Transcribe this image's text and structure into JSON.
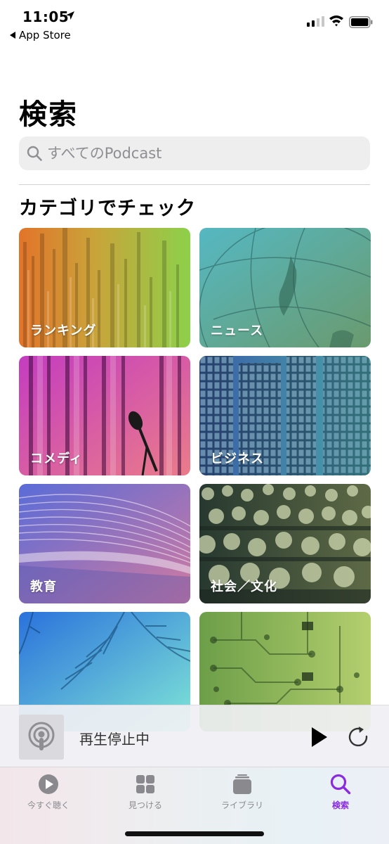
{
  "status_bar": {
    "time": "11:05",
    "back_app": "App Store"
  },
  "page": {
    "title": "検索"
  },
  "search": {
    "placeholder": "すべてのPodcast",
    "value": ""
  },
  "section": {
    "title": "カテゴリでチェック"
  },
  "categories": [
    {
      "label": "ランキング",
      "icon": "ranking-bars",
      "colors": [
        "#e67e22",
        "#8ed14a"
      ]
    },
    {
      "label": "ニュース",
      "icon": "globe",
      "colors": [
        "#4fb3bc",
        "#6a9e6a"
      ]
    },
    {
      "label": "コメディ",
      "icon": "curtain-microphone",
      "colors": [
        "#c040b8",
        "#e87a8a"
      ]
    },
    {
      "label": "ビジネス",
      "icon": "skyscrapers",
      "colors": [
        "#3a5fa8",
        "#4aa5a8"
      ]
    },
    {
      "label": "教育",
      "icon": "open-book",
      "colors": [
        "#5b6fd6",
        "#d07aa0"
      ]
    },
    {
      "label": "社会／文化",
      "icon": "crowd",
      "colors": [
        "#22332c",
        "#c9d68a"
      ]
    },
    {
      "label": "",
      "icon": "palm-leaves",
      "colors": [
        "#2f7fe0",
        "#7fe3d8"
      ]
    },
    {
      "label": "",
      "icon": "circuit-board",
      "colors": [
        "#6fa04a",
        "#b6d070"
      ]
    }
  ],
  "mini_player": {
    "status": "再生停止中"
  },
  "tabs": [
    {
      "label": "今すぐ聴く",
      "icon": "play-circle-icon",
      "active": false
    },
    {
      "label": "見つける",
      "icon": "grid-icon",
      "active": false
    },
    {
      "label": "ライブラリ",
      "icon": "library-icon",
      "active": false
    },
    {
      "label": "検索",
      "icon": "search-icon",
      "active": true
    }
  ],
  "colors": {
    "accent": "#8a2be2",
    "tab_inactive": "#8a8a8e"
  }
}
